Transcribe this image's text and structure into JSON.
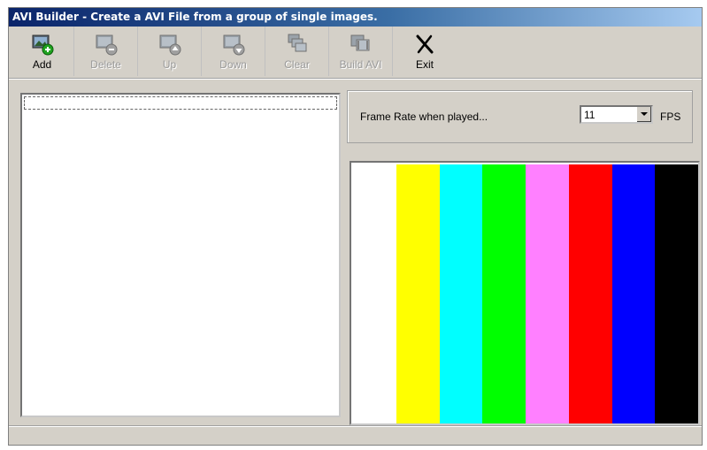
{
  "window": {
    "title": "AVI Builder - Create a AVI File from a group of single images."
  },
  "toolbar": {
    "buttons": [
      {
        "label": "Add",
        "icon": "image-add-icon",
        "enabled": true
      },
      {
        "label": "Delete",
        "icon": "image-remove-icon",
        "enabled": false
      },
      {
        "label": "Up",
        "icon": "image-move-up-icon",
        "enabled": false
      },
      {
        "label": "Down",
        "icon": "image-move-down-icon",
        "enabled": false
      },
      {
        "label": "Clear",
        "icon": "clear-images-icon",
        "enabled": false
      },
      {
        "label": "Build AVI",
        "icon": "build-avi-icon",
        "enabled": false
      },
      {
        "label": "Exit",
        "icon": "exit-x-icon",
        "enabled": true
      }
    ]
  },
  "frame_rate": {
    "label": "Frame Rate when played...",
    "value": "11",
    "unit": "FPS"
  },
  "preview": {
    "colors": [
      "#ffffff",
      "#ffff00",
      "#00ffff",
      "#00ff00",
      "#ff80ff",
      "#ff0000",
      "#0000ff",
      "#000000"
    ]
  }
}
